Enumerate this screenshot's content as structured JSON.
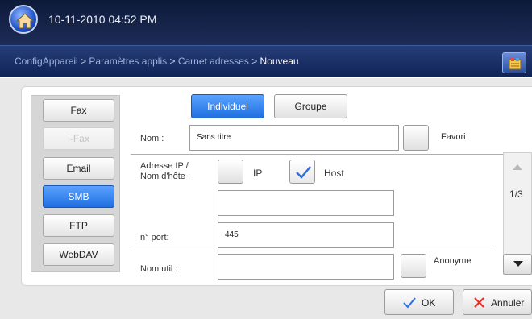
{
  "header": {
    "datetime": "10-11-2010 04:52 PM"
  },
  "breadcrumb": {
    "items": [
      "ConfigAppareil",
      "Paramètres applis",
      "Carnet adresses",
      "Nouveau"
    ],
    "separator": ">"
  },
  "nav": {
    "items": [
      {
        "label": "Fax",
        "state": "normal"
      },
      {
        "label": "i-Fax",
        "state": "disabled"
      },
      {
        "label": "Email",
        "state": "normal"
      },
      {
        "label": "SMB",
        "state": "active"
      },
      {
        "label": "FTP",
        "state": "normal"
      },
      {
        "label": "WebDAV",
        "state": "normal"
      }
    ]
  },
  "type_toggle": {
    "individual": "Individuel",
    "group": "Groupe",
    "selected": "Individuel"
  },
  "form": {
    "name_label": "Nom :",
    "name_value": "Sans titre",
    "favorite_label": "Favori",
    "address_label_line1": "Adresse IP /",
    "address_label_line2": "Nom d'hôte :",
    "ip_label": "IP",
    "host_label": "Host",
    "host_value": "",
    "port_label": "n° port:",
    "port_value": "445",
    "user_label": "Nom util :",
    "user_value": "",
    "anonymous_label": "Anonyme",
    "ip_checked": false,
    "host_checked": true,
    "favorite_checked": false,
    "anonymous_checked": false
  },
  "pager": {
    "indicator": "1/3"
  },
  "footer": {
    "ok_label": "OK",
    "cancel_label": "Annuler"
  },
  "colors": {
    "accent": "#1f6fe0",
    "topbar": "#0d1a3a",
    "checkmark": "#2f6ee0",
    "cancel_x": "#e0332b"
  }
}
